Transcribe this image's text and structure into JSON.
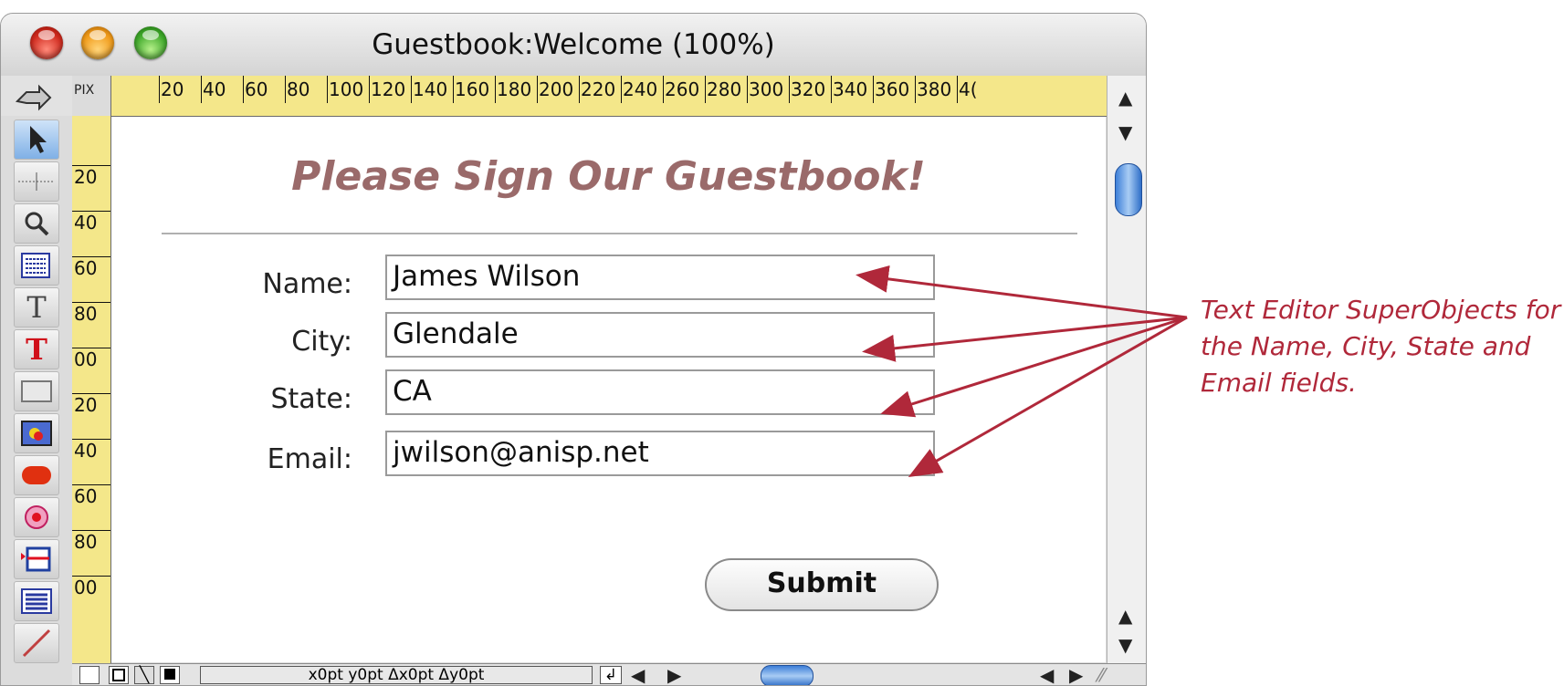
{
  "window": {
    "title": "Guestbook:Welcome (100%)",
    "ruler_unit": "PIX",
    "hruler_labels": [
      "20",
      "40",
      "60",
      "80",
      "100",
      "120",
      "140",
      "160",
      "180",
      "200",
      "220",
      "240",
      "260",
      "280",
      "300",
      "320",
      "340",
      "360",
      "380",
      "4("
    ],
    "vruler_labels": [
      "20",
      "40",
      "60",
      "80",
      "00",
      "20",
      "40",
      "60",
      "80",
      "00"
    ]
  },
  "form": {
    "heading": "Please Sign Our Guestbook!",
    "fields": [
      {
        "label": "Name:",
        "value": "James Wilson"
      },
      {
        "label": "City:",
        "value": "Glendale"
      },
      {
        "label": "State:",
        "value": "CA"
      },
      {
        "label": "Email:",
        "value": "jwilson@anisp.net"
      }
    ],
    "submit_label": "Submit"
  },
  "status": {
    "coords": "x0pt y0pt Δx0pt Δy0pt"
  },
  "annotation": {
    "text": "Text Editor SuperObjects for the Name, City, State and Email fields.",
    "color": "#b0283a"
  },
  "tools": [
    "pointer-icon",
    "crosshair-icon",
    "magnifier-icon",
    "text-editor-icon",
    "text-icon",
    "red-text-icon",
    "rectangle-icon",
    "picture-icon",
    "button-icon",
    "radio-icon",
    "popup-icon",
    "list-icon",
    "line-icon"
  ]
}
